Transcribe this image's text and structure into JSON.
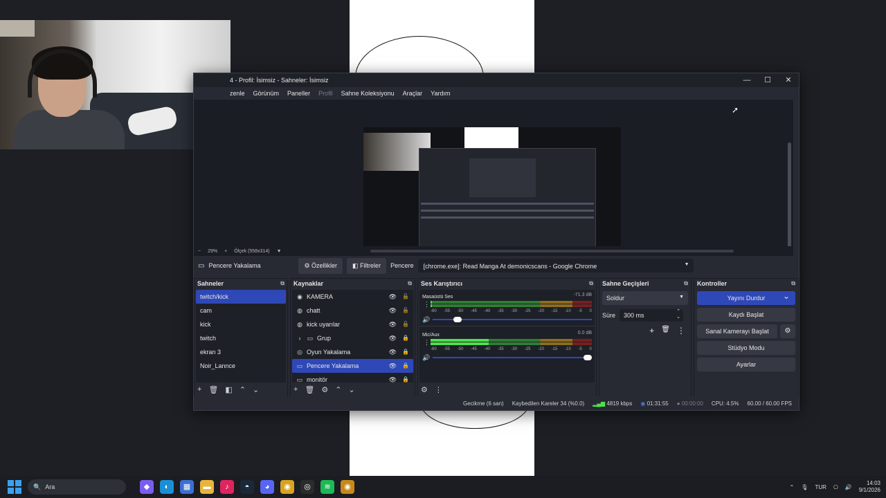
{
  "window": {
    "title": "4 - Profil: İsimsiz - Sahneler: İsimsiz",
    "minimize": "—",
    "maximize": "☐",
    "close": "✕"
  },
  "menu": [
    {
      "label": "zenle",
      "disabled": false
    },
    {
      "label": "Görünüm",
      "disabled": false
    },
    {
      "label": "Paneller",
      "disabled": false
    },
    {
      "label": "Profil",
      "disabled": true
    },
    {
      "label": "Sahne Koleksiyonu",
      "disabled": false
    },
    {
      "label": "Araçlar",
      "disabled": false
    },
    {
      "label": "Yardım",
      "disabled": false
    }
  ],
  "zoom": {
    "minus": "−",
    "value": "29%",
    "plus": "+",
    "scale": "Ölçek (558x314)"
  },
  "source_toolbar": {
    "selected_source": "Pencere Yakalama",
    "properties": "Özellikler",
    "filters": "Filtreler",
    "window_label": "Pencere",
    "window_value": "[chrome.exe]: Read Manga At demonicscans - Google Chrome"
  },
  "scenes": {
    "title": "Sahneler",
    "items": [
      "twitch/kick",
      "cam",
      "kick",
      "twitch",
      "ekran 3",
      "Noir_Lannce"
    ],
    "selected_index": 0
  },
  "sources": {
    "title": "Kaynaklar",
    "items": [
      {
        "label": "KAMERA",
        "icon": "camera-icon",
        "glyph": "◉",
        "locked": false
      },
      {
        "label": "chatt",
        "icon": "browser-icon",
        "glyph": "◍",
        "locked": false
      },
      {
        "label": "kick uyarılar",
        "icon": "browser-icon",
        "glyph": "◍",
        "locked": false
      },
      {
        "label": "Grup",
        "icon": "folder-icon",
        "glyph": "▸",
        "locked": true
      },
      {
        "label": "Oyun Yakalama",
        "icon": "gamepad-icon",
        "glyph": "◎",
        "locked": true
      },
      {
        "label": "Pencere Yakalama",
        "icon": "window-icon",
        "glyph": "▭",
        "locked": true
      },
      {
        "label": "monitör",
        "icon": "monitor-icon",
        "glyph": "▭",
        "locked": true
      }
    ],
    "selected_index": 5
  },
  "mixer": {
    "title": "Ses Karıştırıcı",
    "ticks": [
      "-60",
      "-55",
      "-50",
      "-45",
      "-40",
      "-35",
      "-30",
      "-25",
      "-20",
      "-15",
      "-10",
      "-5",
      "0"
    ],
    "channels": [
      {
        "name": "Masaüstü Ses",
        "db": "-71.3 dB",
        "level": 0.01,
        "volume": 0.18
      },
      {
        "name": "Mic/Aux",
        "db": "0.0 dB",
        "level": 0.36,
        "volume": 1.0
      }
    ]
  },
  "transitions": {
    "title": "Sahne Geçişleri",
    "type": "Soldur",
    "duration_label": "Süre",
    "duration_value": "300 ms"
  },
  "controls": {
    "title": "Kontroller",
    "stop_stream": "Yayını Durdur",
    "start_recording": "Kaydı Başlat",
    "virtual_camera": "Sanal Kamerayı Başlat",
    "studio_mode": "Stüdyo Modu",
    "settings": "Ayarlar"
  },
  "status": {
    "delay": "Gecikme (6 san)",
    "dropped_frames": "Kaybedilen Kareler 34 (%0.0)",
    "bitrate": "4819 kbps",
    "stream_time": "01:31:55",
    "record_time": "00:00:00",
    "cpu": "CPU: 4.5%",
    "fps": "60.00 / 60.00 FPS"
  },
  "taskbar": {
    "search_placeholder": "Ara",
    "language": "TUR",
    "time": "14:03",
    "date": "9/1/2026",
    "apps": [
      {
        "name": "copilot-icon",
        "glyph": "◆",
        "color": "#7a5cf0"
      },
      {
        "name": "edge-icon",
        "glyph": "◐",
        "color": "#1a8fd6"
      },
      {
        "name": "store-icon",
        "glyph": "▦",
        "color": "#3b6fd1"
      },
      {
        "name": "file-explorer-icon",
        "glyph": "▬",
        "color": "#e8b43c"
      },
      {
        "name": "tiktok-icon",
        "glyph": "♪",
        "color": "#e0245e"
      },
      {
        "name": "steam-icon",
        "glyph": "◓",
        "color": "#1b2838"
      },
      {
        "name": "discord-icon",
        "glyph": "◕",
        "color": "#5865f2"
      },
      {
        "name": "chrome-icon",
        "glyph": "◉",
        "color": "#d8a321"
      },
      {
        "name": "obs-icon",
        "glyph": "◎",
        "color": "#2b2b2b"
      },
      {
        "name": "spotify-icon",
        "glyph": "≋",
        "color": "#1db954"
      },
      {
        "name": "chrome-canary-icon",
        "glyph": "◉",
        "color": "#c68a1a"
      }
    ]
  }
}
